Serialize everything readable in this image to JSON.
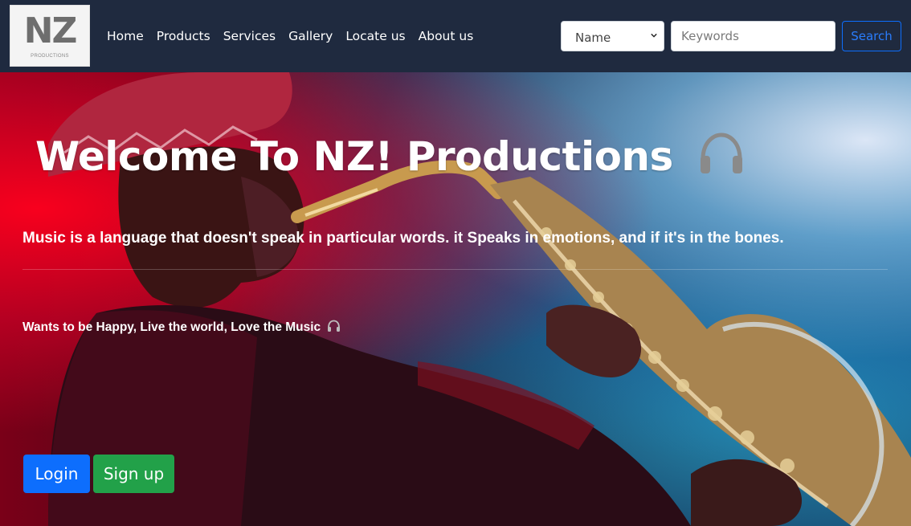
{
  "logo": {
    "title": "NZ",
    "subtitle": "PRODUCTIONS"
  },
  "nav": {
    "items": [
      "Home",
      "Products",
      "Services",
      "Gallery",
      "Locate us",
      "About us"
    ]
  },
  "search": {
    "select_value": "Name",
    "placeholder": "Keywords",
    "button_label": "Search"
  },
  "hero": {
    "title": "Welcome To NZ! Productions",
    "tagline": "Music is a language that doesn't speak in particular words. it Speaks in emotions, and if it's in the bones.",
    "subtagline": "Wants to be Happy, Live the world, Love the Music",
    "icon": "headphones-icon"
  },
  "buttons": {
    "login": "Login",
    "signup": "Sign up"
  },
  "colors": {
    "navbar": "#1f2a3f",
    "primary": "#0d6efd",
    "success": "#22a149"
  }
}
